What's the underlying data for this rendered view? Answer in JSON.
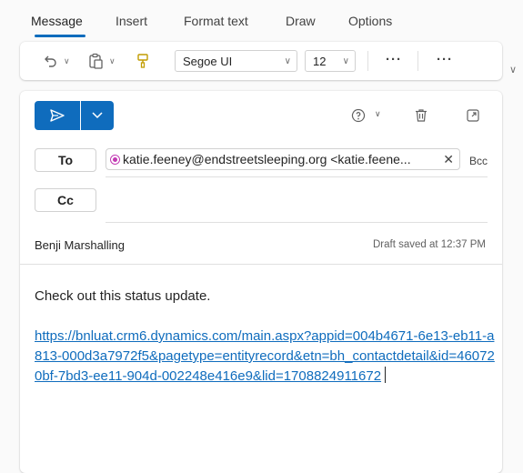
{
  "tabs": [
    "Message",
    "Insert",
    "Format text",
    "Draw",
    "Options"
  ],
  "ribbon": {
    "font_name": "Segoe UI",
    "font_size": "12",
    "more_1": "···",
    "more_2": "···"
  },
  "compose": {
    "to_label": "To",
    "cc_label": "Cc",
    "bcc_label": "Bcc",
    "recipient": "katie.feeney@endstreetsleeping.org <katie.feene...",
    "sender": "Benji Marshalling",
    "draft_status": "Draft saved at 12:37 PM",
    "body_text": "Check out this status update.",
    "link": "https://bnluat.crm6.dynamics.com/main.aspx?appid=004b4671-6e13-eb11-a813-000d3a7972f5&pagetype=entityrecord&etn=bh_contactdetail&id=460720bf-7bd3-ee11-904d-002248e416e9&lid=1708824911672"
  },
  "colors": {
    "accent": "#0f6cbd",
    "chip_icon": "#c239b3"
  },
  "icons": [
    "undo-icon",
    "paste-icon",
    "format-painter-icon",
    "send-icon",
    "sensitivity-icon",
    "delete-icon",
    "popout-icon",
    "close-icon"
  ]
}
